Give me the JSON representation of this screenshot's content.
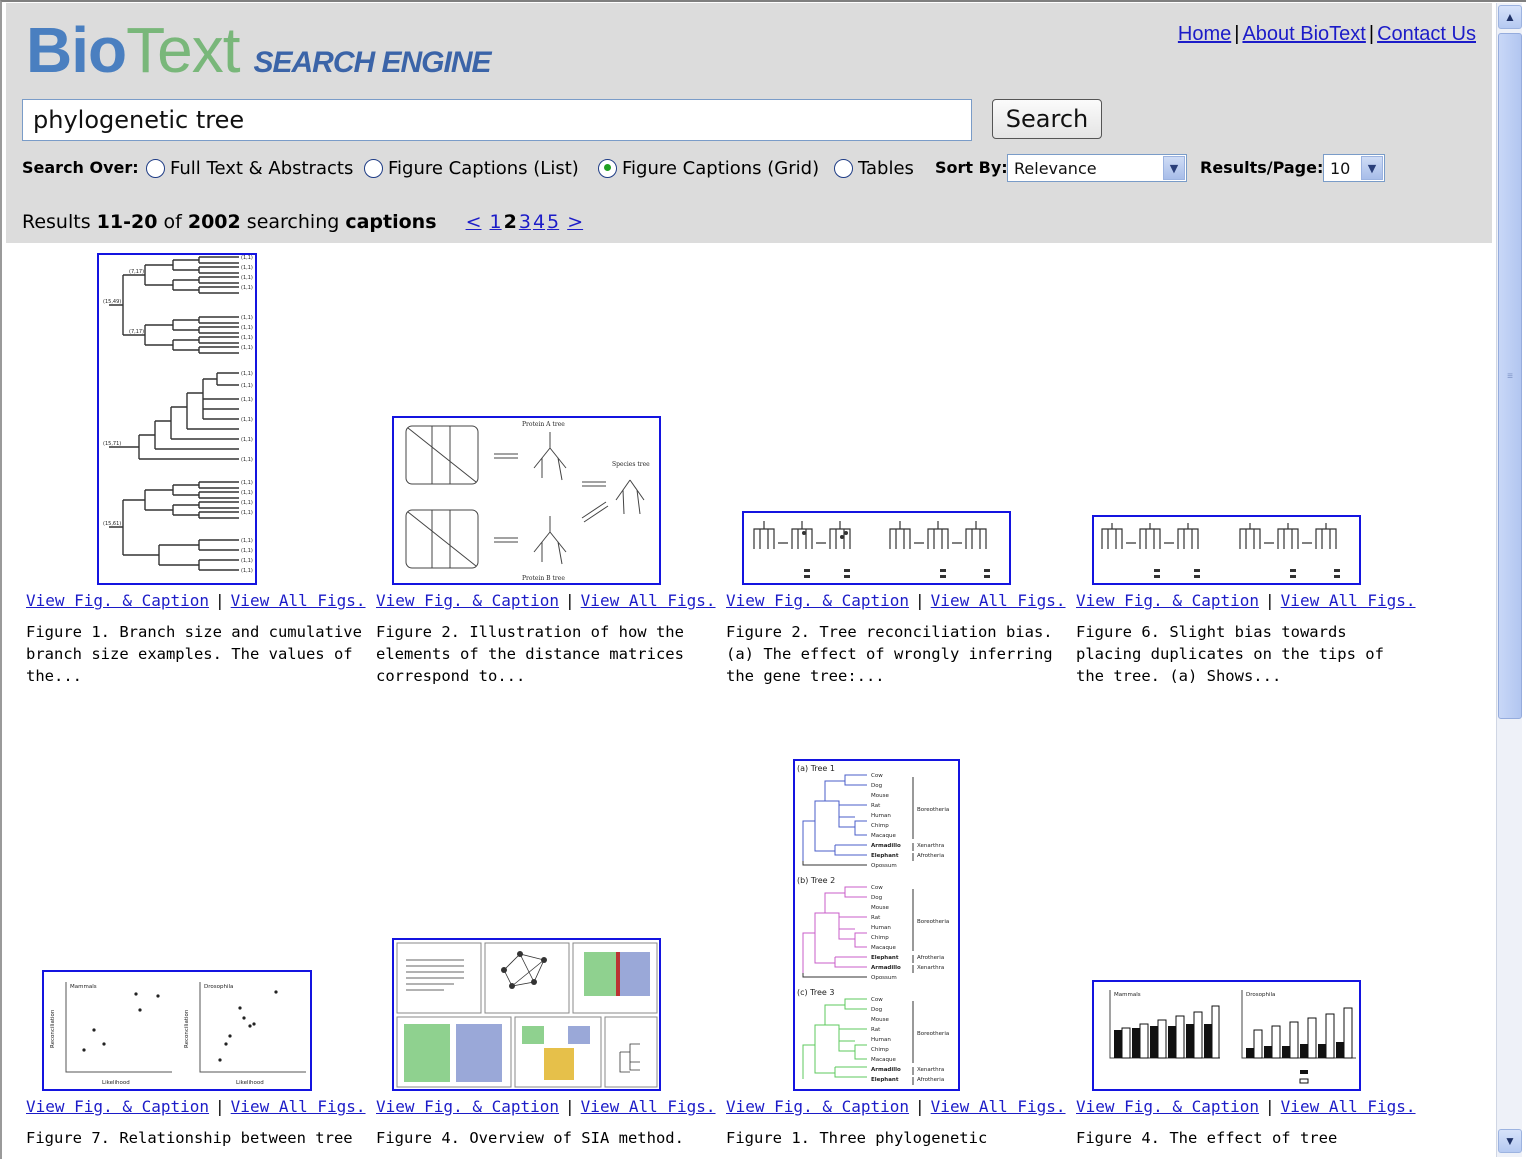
{
  "logo": {
    "bio": "Bio",
    "text": "Text",
    "sub": "SEARCH ENGINE"
  },
  "nav": {
    "home": "Home",
    "about": "About BioText",
    "contact": "Contact Us",
    "sep": "|"
  },
  "search": {
    "query": "phylogenetic tree",
    "button": "Search"
  },
  "options": {
    "search_over_label": "Search Over:",
    "radios": [
      {
        "label": "Full Text & Abstracts",
        "checked": false
      },
      {
        "label": "Figure Captions (List)",
        "checked": false
      },
      {
        "label": "Figure Captions (Grid)",
        "checked": true
      },
      {
        "label": "Tables",
        "checked": false
      }
    ],
    "sort_label": "Sort By:",
    "sort_value": "Relevance",
    "per_page_label": "Results/Page:",
    "per_page_value": "10"
  },
  "results": {
    "prefix": "Results",
    "range": "11-20",
    "of": "of",
    "total": "2002",
    "searching": "searching",
    "scope": "captions",
    "pager": {
      "prev": "<",
      "pages": [
        "1",
        "2",
        "3",
        "4",
        "5"
      ],
      "current": "2",
      "next": ">"
    }
  },
  "items": [
    {
      "link1": "View Fig. & Caption",
      "link2": "View All Figs.",
      "caption": "Figure 1. Branch size and cumulative branch size examples. The values of the..."
    },
    {
      "link1": "View Fig. & Caption",
      "link2": "View All Figs.",
      "caption": "Figure 2. Illustration of how the elements of the distance matrices correspond to..."
    },
    {
      "link1": "View Fig. & Caption",
      "link2": "View All Figs.",
      "caption": "Figure 2. Tree reconciliation bias. (a) The effect of wrongly inferring the gene tree:..."
    },
    {
      "link1": "View Fig. & Caption",
      "link2": "View All Figs.",
      "caption": "Figure 6. Slight bias towards placing duplicates on the tips of the tree. (a) Shows..."
    },
    {
      "link1": "View Fig. & Caption",
      "link2": "View All Figs.",
      "caption": "Figure 7. Relationship between tree"
    },
    {
      "link1": "View Fig. & Caption",
      "link2": "View All Figs.",
      "caption": "Figure 4. Overview of SIA method."
    },
    {
      "link1": "View Fig. & Caption",
      "link2": "View All Figs.",
      "caption": "Figure 1. Three phylogenetic"
    },
    {
      "link1": "View Fig. & Caption",
      "link2": "View All Figs.",
      "caption": "Figure 4. The effect of tree"
    }
  ],
  "figure_text": {
    "proteinA": "Protein A tree",
    "proteinB": "Protein B tree",
    "species": "Species tree",
    "tree1": "(a) Tree 1",
    "tree2": "(b) Tree 2",
    "tree3": "(c) Tree 3",
    "taxa1": [
      "Cow",
      "Dog",
      "Mouse",
      "Rat",
      "Human",
      "Chimp",
      "Macaque",
      "Armadillo",
      "Elephant",
      "Opossum"
    ],
    "taxa2": [
      "Cow",
      "Dog",
      "Mouse",
      "Rat",
      "Human",
      "Chimp",
      "Macaque",
      "Elephant",
      "Armadillo",
      "Opossum"
    ],
    "clades1": [
      "Boreotheria",
      "Xenarthra",
      "Afrotheria"
    ],
    "clades2": [
      "Boreotheria",
      "Afrotheria",
      "Xenarthra"
    ],
    "mammals": "Mammals",
    "drosophila": "Drosophila",
    "likelihood": "Likelihood",
    "reconciliation": "Reconciliation"
  },
  "colors": {
    "link": "#1c1cc8",
    "thumb_border": "#1414e0",
    "header_bg": "#dcdcdc",
    "logo_blue": "#4a7fc0",
    "logo_green": "#79b77a"
  }
}
